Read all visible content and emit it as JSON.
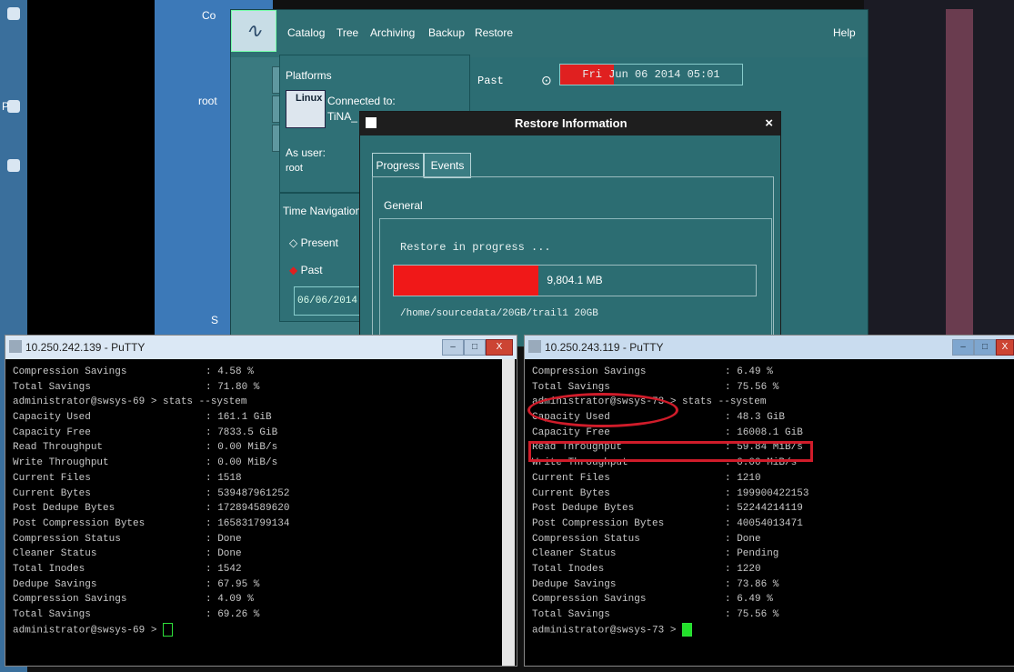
{
  "desktop": {
    "fragments": [
      "Co",
      "root",
      "P",
      "S"
    ]
  },
  "app": {
    "menu": [
      "Catalog",
      "Tree",
      "Archiving",
      "Backup",
      "Restore",
      "Help"
    ],
    "platforms_label": "Platforms",
    "os_badge": "Linux",
    "connected_to": "Connected to:",
    "host_fragment": "TiNA_",
    "as_user_label": "As user:",
    "user": "root",
    "time_nav_label": "Time Navigation",
    "present_label": "Present",
    "past_option_label": "Past",
    "date_field": "06/06/2014",
    "past_label": "Past",
    "past_datetime": "Fri Jun 06 2014 05:01",
    "colors": {
      "panel": "#2c6d72",
      "accent_red": "#e02020"
    }
  },
  "dialog": {
    "title": "Restore Information",
    "close_glyph": "×",
    "tabs": [
      "Progress",
      "Events"
    ],
    "group_label": "General",
    "status_text": "Restore in progress ...",
    "progress_value": "9,804.1 MB",
    "progress_fraction": 0.4,
    "path": "/home/sourcedata/20GB/trail1 20GB"
  },
  "putty_left": {
    "title": "10.250.242.139 - PuTTY",
    "lines": [
      {
        "k": "Compression Savings",
        "v": ": 4.58 %"
      },
      {
        "k": "Total Savings",
        "v": ": 71.80 %"
      },
      {
        "k": "administrator@swsys-69 > stats --system",
        "v": ""
      },
      {
        "k": "Capacity Used",
        "v": ": 161.1 GiB"
      },
      {
        "k": "Capacity Free",
        "v": ": 7833.5 GiB"
      },
      {
        "k": "Read Throughput",
        "v": ": 0.00 MiB/s"
      },
      {
        "k": "Write Throughput",
        "v": ": 0.00 MiB/s"
      },
      {
        "k": "Current Files",
        "v": ": 1518"
      },
      {
        "k": "Current Bytes",
        "v": ": 539487961252"
      },
      {
        "k": "Post Dedupe Bytes",
        "v": ": 172894589620"
      },
      {
        "k": "Post Compression Bytes",
        "v": ": 165831799134"
      },
      {
        "k": "Compression Status",
        "v": ": Done"
      },
      {
        "k": "Cleaner Status",
        "v": ": Done"
      },
      {
        "k": "Total Inodes",
        "v": ": 1542"
      },
      {
        "k": "Dedupe Savings",
        "v": ": 67.95 %"
      },
      {
        "k": "Compression Savings",
        "v": ": 4.09 %"
      },
      {
        "k": "Total Savings",
        "v": ": 69.26 %"
      },
      {
        "k": "administrator@swsys-69 > ",
        "v": ""
      }
    ],
    "cursor_color": "#000000"
  },
  "putty_right": {
    "title": "10.250.243.119 - PuTTY",
    "lines": [
      {
        "k": "Compression Savings",
        "v": ": 6.49 %"
      },
      {
        "k": "Total Savings",
        "v": ": 75.56 %"
      },
      {
        "k": "administrator@swsys-73 > stats --system",
        "v": ""
      },
      {
        "k": "Capacity Used",
        "v": ": 48.3 GiB"
      },
      {
        "k": "Capacity Free",
        "v": ": 16008.1 GiB"
      },
      {
        "k": "Read Throughput",
        "v": ": 59.84 MiB/s"
      },
      {
        "k": "Write Throughput",
        "v": ": 0.00 MiB/s"
      },
      {
        "k": "Current Files",
        "v": ": 1210"
      },
      {
        "k": "Current Bytes",
        "v": ": 199900422153"
      },
      {
        "k": "Post Dedupe Bytes",
        "v": ": 52244214119"
      },
      {
        "k": "Post Compression Bytes",
        "v": ": 40054013471"
      },
      {
        "k": "Compression Status",
        "v": ": Done"
      },
      {
        "k": "Cleaner Status",
        "v": ": Pending"
      },
      {
        "k": "Total Inodes",
        "v": ": 1220"
      },
      {
        "k": "Dedupe Savings",
        "v": ": 73.86 %"
      },
      {
        "k": "Compression Savings",
        "v": ": 6.49 %"
      },
      {
        "k": "Total Savings",
        "v": ": 75.56 %"
      },
      {
        "k": "administrator@swsys-73 > ",
        "v": ""
      }
    ],
    "cursor_color": "#22e02a",
    "annotation_color": "#d01c2a"
  }
}
